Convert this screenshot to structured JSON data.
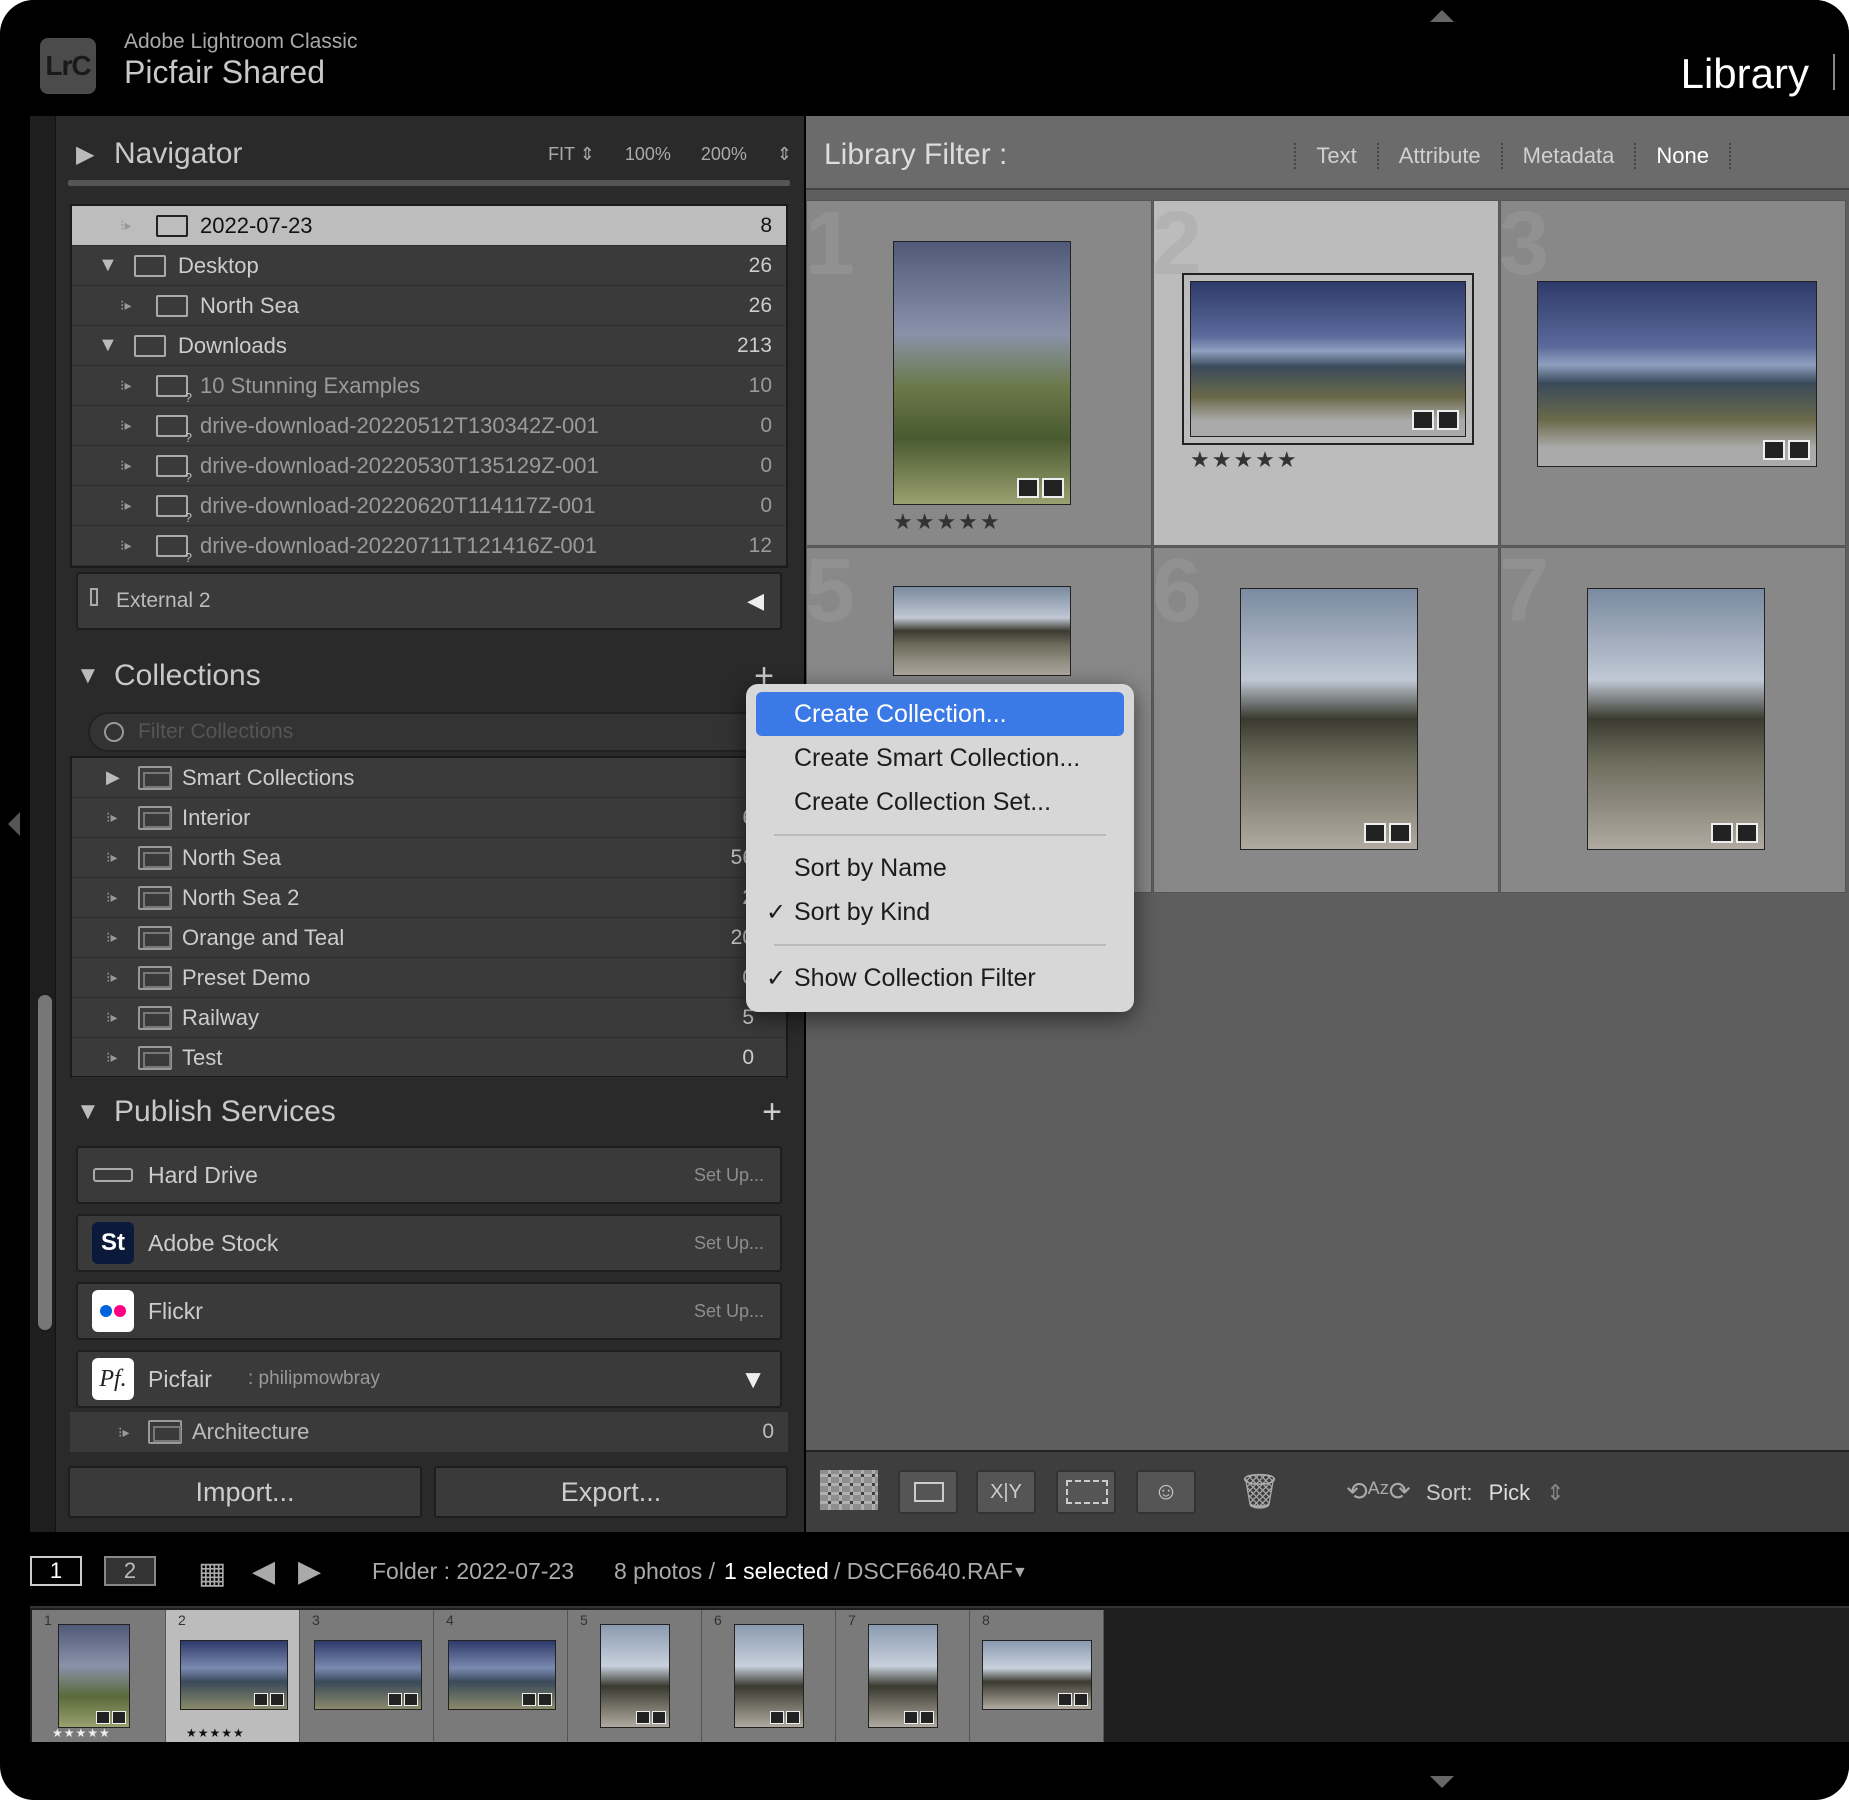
{
  "topbar": {
    "app_name": "Adobe Lightroom Classic",
    "catalog": "Picfair Shared",
    "module": "Library",
    "logo": "LrC"
  },
  "navigator": {
    "title": "Navigator",
    "opts": [
      "FIT ⇕",
      "100%",
      "200%",
      "⇕"
    ]
  },
  "folders": [
    {
      "label": "2022-07-23",
      "count": "8",
      "level": 1,
      "selected": true
    },
    {
      "label": "Desktop",
      "count": "26",
      "level": 0,
      "expanded": true
    },
    {
      "label": "North Sea",
      "count": "26",
      "level": 1
    },
    {
      "label": "Downloads",
      "count": "213",
      "level": 0,
      "expanded": true
    },
    {
      "label": "10 Stunning Examples",
      "count": "10",
      "level": 1,
      "missing": true
    },
    {
      "label": "drive-download-20220512T130342Z-001",
      "count": "0",
      "level": 1,
      "missing": true
    },
    {
      "label": "drive-download-20220530T135129Z-001",
      "count": "0",
      "level": 1,
      "missing": true
    },
    {
      "label": "drive-download-20220620T114117Z-001",
      "count": "0",
      "level": 1,
      "missing": true
    },
    {
      "label": "drive-download-20220711T121416Z-001",
      "count": "12",
      "level": 1,
      "missing": true
    }
  ],
  "volume": {
    "label": "External 2"
  },
  "collections": {
    "title": "Collections",
    "search_placeholder": "Filter Collections",
    "items": [
      {
        "label": "Smart Collections",
        "count": ""
      },
      {
        "label": "Interior",
        "count": "6"
      },
      {
        "label": "North Sea",
        "count": "56"
      },
      {
        "label": "North Sea 2",
        "count": "2"
      },
      {
        "label": "Orange and Teal",
        "count": "20"
      },
      {
        "label": "Preset Demo",
        "count": "0"
      },
      {
        "label": "Railway",
        "count": "5"
      },
      {
        "label": "Test",
        "count": "0"
      }
    ]
  },
  "publish": {
    "title": "Publish Services",
    "services": [
      {
        "label": "Hard Drive",
        "action": "Set Up..."
      },
      {
        "label": "Adobe Stock",
        "action": "Set Up..."
      },
      {
        "label": "Flickr",
        "action": "Set Up..."
      }
    ],
    "picfair": {
      "label": "Picfair",
      "account": ": philipmowbray",
      "child": "Architecture",
      "child_count": "0"
    }
  },
  "buttons": {
    "import": "Import...",
    "export": "Export..."
  },
  "library_filter": {
    "label": "Library Filter :",
    "options": [
      "Text",
      "Attribute",
      "Metadata",
      "None"
    ]
  },
  "grid": {
    "cells": [
      {
        "num": "1",
        "stars": "★★★★★"
      },
      {
        "num": "2",
        "stars": "★★★★★",
        "selected": true
      },
      {
        "num": "3",
        "stars": ""
      },
      {
        "num": "5",
        "stars": ""
      },
      {
        "num": "6",
        "stars": ""
      },
      {
        "num": "7",
        "stars": ""
      }
    ]
  },
  "context_menu": {
    "items": [
      {
        "label": "Create Collection...",
        "highlight": true
      },
      {
        "label": "Create Smart Collection..."
      },
      {
        "label": "Create Collection Set..."
      },
      {
        "label": "Sort by Name",
        "sep_before": true
      },
      {
        "label": "Sort by Kind",
        "checked": true
      },
      {
        "label": "Show Collection Filter",
        "checked": true,
        "sep_before": true
      }
    ]
  },
  "toolbar": {
    "sort_label": "Sort:",
    "sort_value": "Pick"
  },
  "filmstrip_header": {
    "page1": "1",
    "page2": "2",
    "folder": "Folder : 2022-07-23",
    "count": "8 photos /",
    "selected": "1 selected",
    "file": "/ DSCF6640.RAF"
  },
  "filmstrip": [
    {
      "num": "1",
      "stars": "★★★★★"
    },
    {
      "num": "2",
      "stars": "★★★★★",
      "selected": true
    },
    {
      "num": "3",
      "stars": ""
    },
    {
      "num": "4",
      "stars": ""
    },
    {
      "num": "5",
      "stars": ""
    },
    {
      "num": "6",
      "stars": ""
    },
    {
      "num": "7",
      "stars": ""
    },
    {
      "num": "8",
      "stars": ""
    }
  ]
}
